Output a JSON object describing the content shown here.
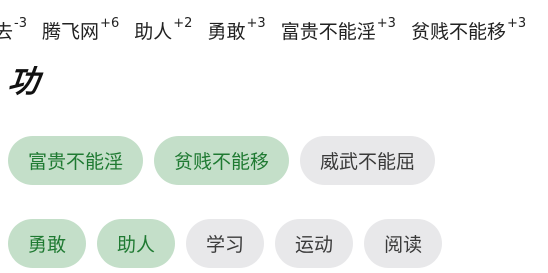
{
  "top_strip": {
    "items": [
      {
        "label": "去",
        "delta": "-3"
      },
      {
        "label": "腾飞网",
        "delta": "+6"
      },
      {
        "label": "助人",
        "delta": "+2"
      },
      {
        "label": "勇敢",
        "delta": "+3"
      },
      {
        "label": "富贵不能淫",
        "delta": "+3"
      },
      {
        "label": "贫贱不能移",
        "delta": "+3"
      }
    ]
  },
  "section": {
    "title": "功"
  },
  "chips": {
    "row1": [
      {
        "label": "富贵不能淫",
        "selected": true
      },
      {
        "label": "贫贱不能移",
        "selected": true
      },
      {
        "label": "威武不能屈",
        "selected": false
      }
    ],
    "row2": [
      {
        "label": "勇敢",
        "selected": true
      },
      {
        "label": "助人",
        "selected": true
      },
      {
        "label": "学习",
        "selected": false
      },
      {
        "label": "运动",
        "selected": false
      },
      {
        "label": "阅读",
        "selected": false
      }
    ]
  },
  "colors": {
    "selected_bg": "#c4dfc9",
    "selected_text": "#1f7a32",
    "unselected_bg": "#e8e8ea",
    "unselected_text": "#3a3a3a"
  }
}
